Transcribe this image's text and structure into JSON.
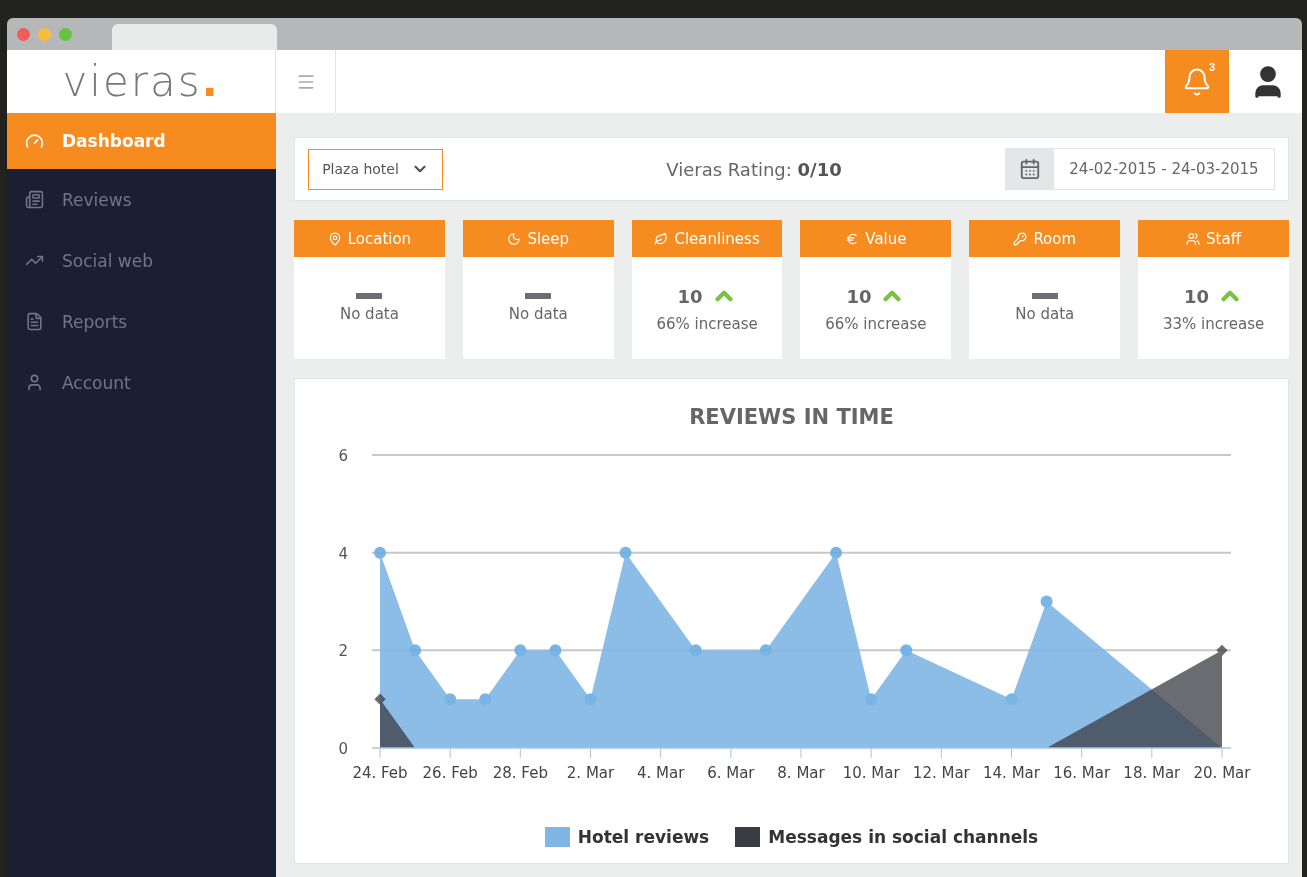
{
  "logo": {
    "text": "vieras",
    "dot": "."
  },
  "notifications": {
    "count": "3"
  },
  "sidebar": {
    "items": [
      {
        "label": "Dashboard",
        "selected": true
      },
      {
        "label": "Reviews",
        "selected": false
      },
      {
        "label": "Social web",
        "selected": false
      },
      {
        "label": "Reports",
        "selected": false
      },
      {
        "label": "Account",
        "selected": false
      }
    ]
  },
  "filter_bar": {
    "hotel": "Plaza hotel",
    "rating_label": "Vieras Rating:",
    "rating_value": "0/10",
    "date_range": "24-02-2015 - 24-03-2015"
  },
  "score_cards": [
    {
      "label": "Location",
      "kind": "empty",
      "text": "No data"
    },
    {
      "label": "Sleep",
      "kind": "empty",
      "text": "No data"
    },
    {
      "label": "Cleanliness",
      "kind": "score",
      "value": "10",
      "text": "66% increase"
    },
    {
      "label": "Value",
      "kind": "score",
      "value": "10",
      "text": "66% increase"
    },
    {
      "label": "Room",
      "kind": "empty",
      "text": "No data"
    },
    {
      "label": "Staff",
      "kind": "score",
      "value": "10",
      "text": "33% increase"
    }
  ],
  "chart": {
    "chart_data": {
      "type": "area",
      "title": "REVIEWS IN TIME",
      "categories": [
        "24. Feb",
        null,
        "26. Feb",
        null,
        "28. Feb",
        null,
        "2. Mar",
        null,
        "4. Mar",
        null,
        "6. Mar",
        null,
        "8. Mar",
        null,
        "10. Mar",
        null,
        "12. Mar",
        null,
        "14. Mar",
        null,
        "16. Mar",
        null,
        "18. Mar",
        null,
        "20. Mar"
      ],
      "yticks": [
        0,
        2,
        4,
        6
      ],
      "ylim": [
        0,
        6
      ],
      "series": [
        {
          "name": "Hotel reviews",
          "color": "#7fb6e4",
          "values": [
            4,
            2,
            1,
            1,
            2,
            2,
            1,
            4,
            null,
            2,
            null,
            2,
            null,
            4,
            1,
            2,
            null,
            null,
            1,
            3,
            null,
            null,
            null,
            null,
            0
          ]
        },
        {
          "name": "Messages in social channels",
          "color": "#3a3c44",
          "values": [
            1,
            0,
            null,
            null,
            null,
            null,
            null,
            null,
            null,
            null,
            null,
            null,
            null,
            null,
            null,
            null,
            null,
            null,
            null,
            0,
            null,
            null,
            null,
            null,
            2
          ]
        }
      ]
    }
  }
}
